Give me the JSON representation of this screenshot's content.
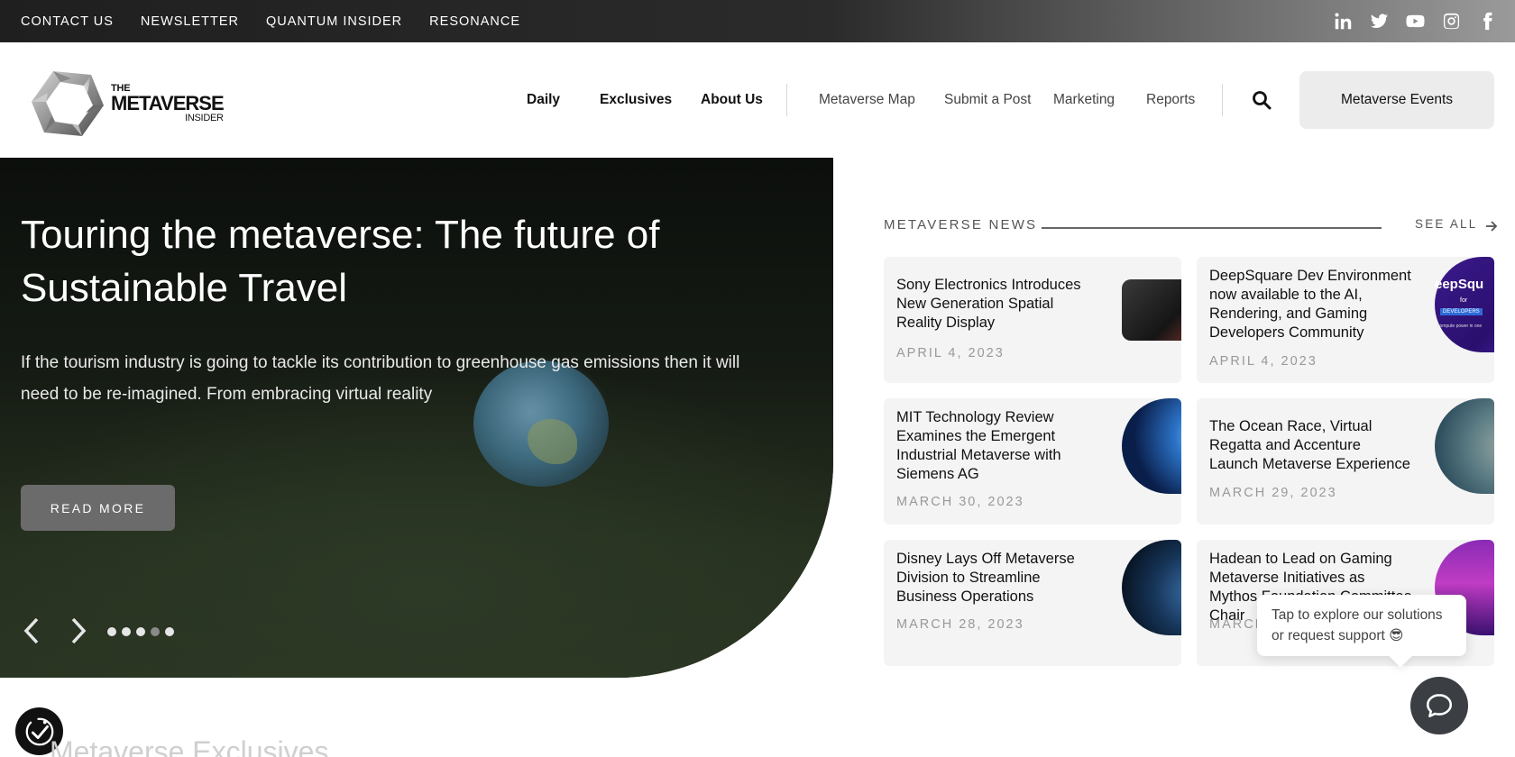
{
  "topbar": {
    "links": [
      "CONTACT US",
      "NEWSLETTER",
      "QUANTUM INSIDER",
      "RESONANCE"
    ],
    "social_icons": [
      "linkedin-icon",
      "twitter-icon",
      "youtube-icon",
      "instagram-icon",
      "facebook-icon"
    ]
  },
  "logo": {
    "the": "THE",
    "metaverse": "METAVERSE",
    "insider": "INSIDER"
  },
  "nav": {
    "primary": [
      "Daily",
      "Exclusives",
      "About Us"
    ],
    "secondary": [
      "Metaverse Map",
      "Submit a Post",
      "Marketing",
      "Reports"
    ],
    "events_label": "Metaverse Events"
  },
  "hero": {
    "title": "Touring the metaverse: The future of Sustainable Travel",
    "description": "If the tourism industry is going to tackle its contribution to greenhouse gas emissions then it will need to be re-imagined. From embracing virtual reality",
    "cta": "READ MORE",
    "slides_total": 5,
    "active_slide": 4
  },
  "news": {
    "section_title": "METAVERSE NEWS",
    "see_all": "SEE ALL",
    "items": [
      {
        "title": "Sony Electronics Introduces New Generation Spatial Reality Display",
        "date": "APRIL 4, 2023"
      },
      {
        "title": "DeepSquare Dev Environment now available to the AI, Rendering, and Gaming Developers Community",
        "date": "APRIL 4, 2023",
        "thumb_text": "eepSqu",
        "thumb_sub": "for",
        "thumb_badge": "DEVELOPERS",
        "thumb_small": "compute power in one"
      },
      {
        "title": "MIT Technology Review Examines the Emergent Industrial Metaverse with Siemens AG",
        "date": "MARCH 30, 2023"
      },
      {
        "title": "The Ocean Race, Virtual Regatta and Accenture Launch Metaverse Experience",
        "date": "MARCH 29, 2023"
      },
      {
        "title": "Disney Lays Off Metaverse Division to Streamline Business Operations",
        "date": "MARCH 28, 2023"
      },
      {
        "title": "Hadean to Lead on Gaming Metaverse Initiatives as Mythos Foundation Committee Chair",
        "date": "MARCH 24, 2023"
      }
    ]
  },
  "chat": {
    "tooltip": "Tap to explore our solutions or request support 😎"
  },
  "below": {
    "section_heading": "Metaverse Exclusives"
  }
}
